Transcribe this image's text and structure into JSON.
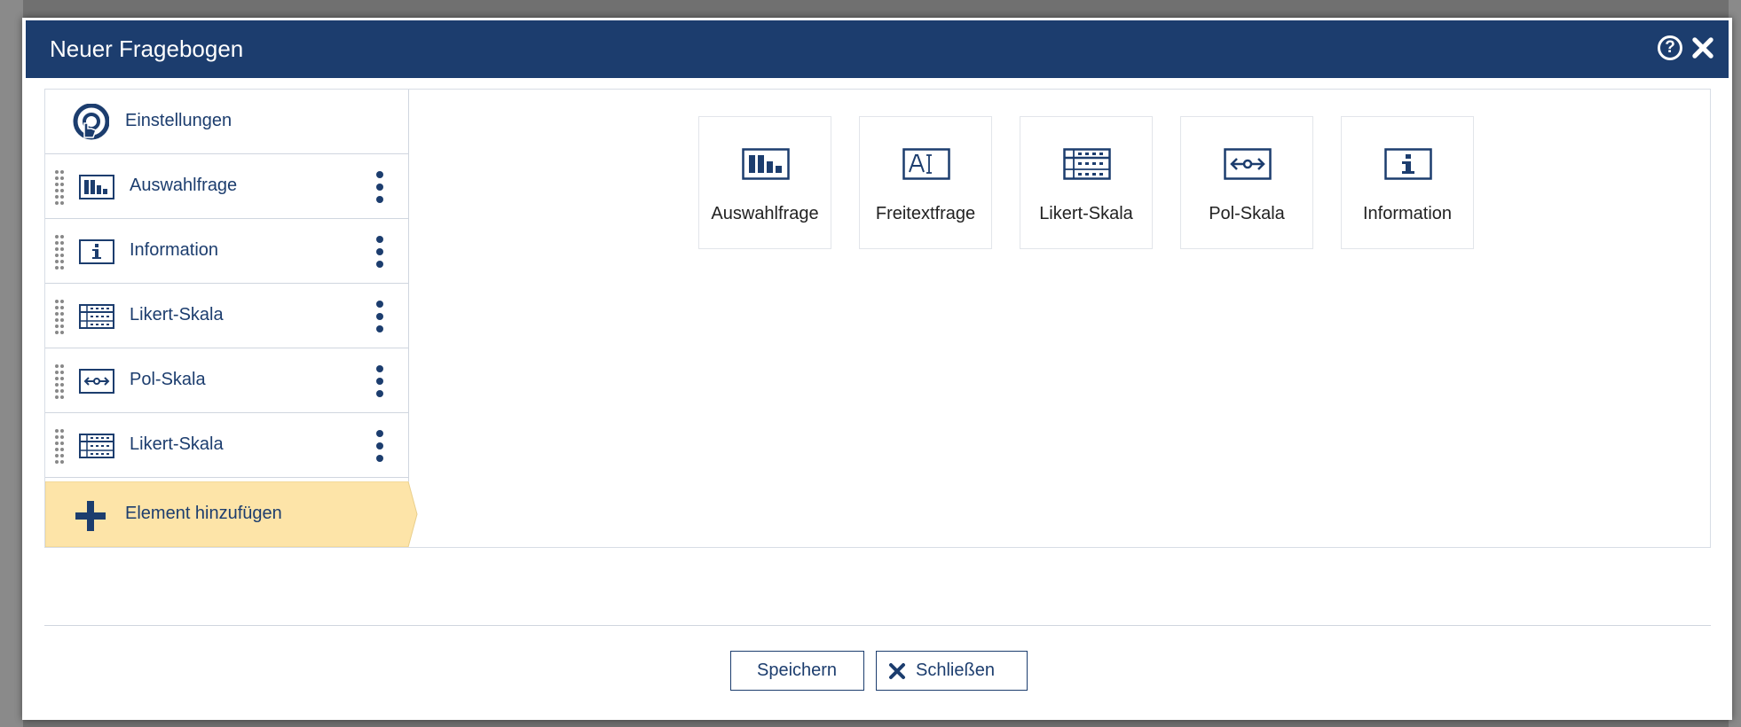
{
  "dialog": {
    "title": "Neuer Fragebogen",
    "help_icon": "question-circle-icon",
    "close_icon": "close-icon"
  },
  "sidebar": {
    "settings": {
      "label": "Einstellungen",
      "icon": "touch-settings-icon"
    },
    "items": [
      {
        "label": "Auswahlfrage",
        "icon": "bar-chart-icon"
      },
      {
        "label": "Information",
        "icon": "info-box-icon"
      },
      {
        "label": "Likert-Skala",
        "icon": "likert-grid-icon"
      },
      {
        "label": "Pol-Skala",
        "icon": "pole-scale-icon"
      },
      {
        "label": "Likert-Skala",
        "icon": "likert-grid-icon"
      }
    ],
    "add_element": {
      "label": "Element hinzufügen",
      "icon": "plus-icon"
    }
  },
  "tiles": [
    {
      "label": "Auswahlfrage",
      "icon": "bar-chart-icon"
    },
    {
      "label": "Freitextfrage",
      "icon": "text-input-icon"
    },
    {
      "label": "Likert-Skala",
      "icon": "likert-grid-icon"
    },
    {
      "label": "Pol-Skala",
      "icon": "pole-scale-icon"
    },
    {
      "label": "Information",
      "icon": "info-box-icon"
    }
  ],
  "footer": {
    "save_label": "Speichern",
    "close_label": "Schließen"
  },
  "colors": {
    "primary": "#1c3d6e",
    "highlight": "#fde4a8",
    "border": "#d0d6df"
  }
}
